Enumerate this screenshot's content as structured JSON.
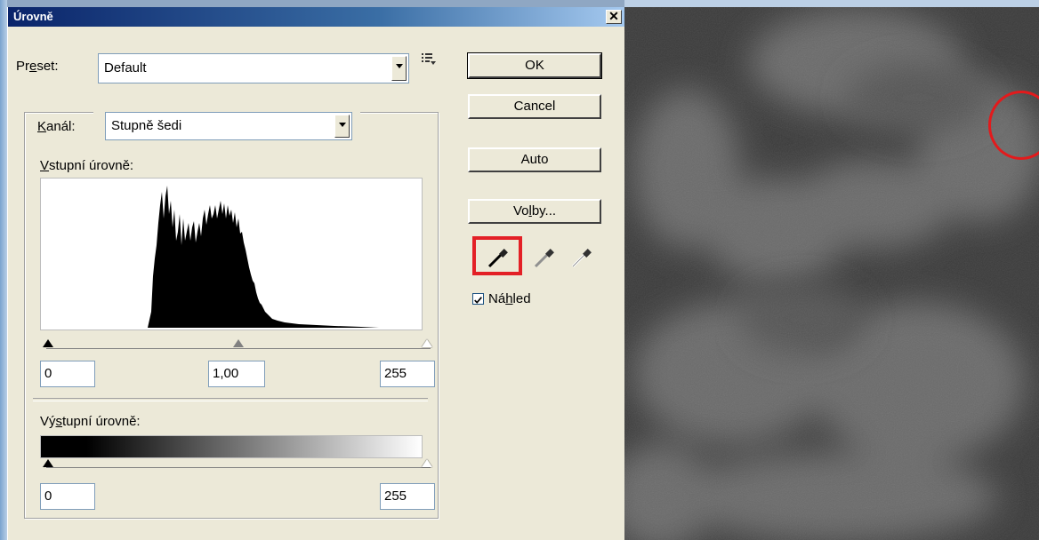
{
  "window": {
    "title": "Úrovně",
    "close_glyph": "✕"
  },
  "preset": {
    "label_pre": "Pr",
    "label_u": "e",
    "label_post": "set:",
    "value": "Default"
  },
  "channel": {
    "label_u": "K",
    "label_post": "anál:",
    "value": "Stupně šedi"
  },
  "input_levels": {
    "label_u": "V",
    "label_post": "stupní úrovně:",
    "black": "0",
    "gamma": "1,00",
    "white": "255"
  },
  "output_levels": {
    "label_pre": "Vý",
    "label_u": "s",
    "label_post": "tupní úrovně:",
    "black": "0",
    "white": "255"
  },
  "buttons": {
    "ok": "OK",
    "cancel": "Cancel",
    "auto": "Auto",
    "options_pre": "Vo",
    "options_u": "l",
    "options_post": "by..."
  },
  "preview": {
    "checked": true,
    "label_pre": "Ná",
    "label_u": "h",
    "label_post": "led"
  },
  "colors": {
    "highlight_red": "#e32026",
    "dialog_bg": "#ece9d8",
    "title_blue": "#0a246a"
  },
  "icons": [
    "preset-menu-icon",
    "eyedropper-black-icon",
    "eyedropper-gray-icon",
    "eyedropper-white-icon",
    "close-icon",
    "checkbox-checked-icon"
  ]
}
